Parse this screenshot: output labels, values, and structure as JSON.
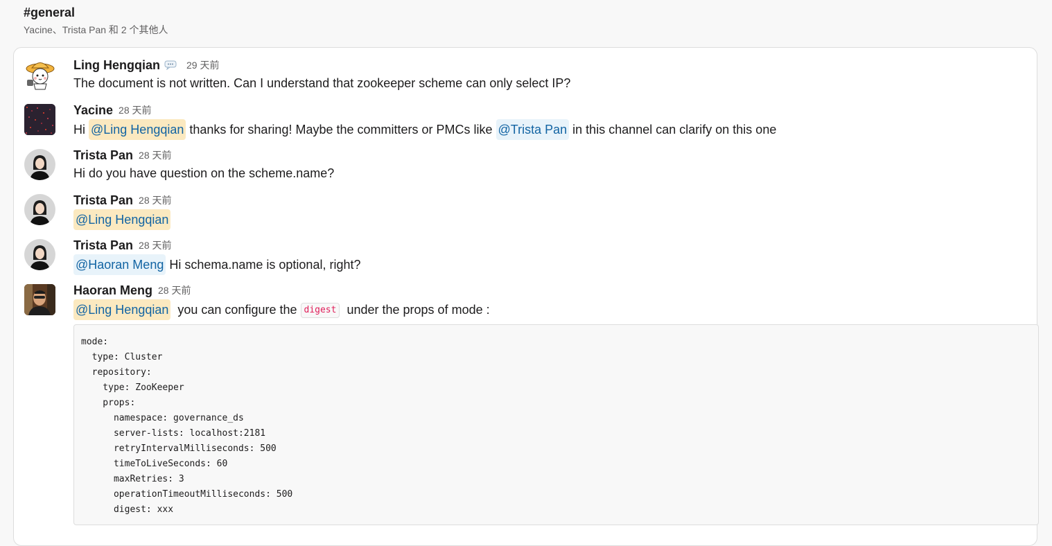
{
  "channel": {
    "name": "#general",
    "members": "Yacine、Trista Pan 和 2 个其他人"
  },
  "messages": [
    {
      "sender": "Ling Hengqian",
      "time": "29 天前",
      "status_icon": "speech-balloon-icon",
      "text": "The document is not written. Can I understand that zookeeper scheme can only select IP?"
    },
    {
      "sender": "Yacine",
      "time": "28 天前",
      "text_a": "Hi ",
      "mention_a": "@Ling Hengqian",
      "text_b": " thanks for sharing! Maybe the committers or PMCs like ",
      "mention_b": "@Trista Pan",
      "text_c": " in this channel can clarify on this one"
    },
    {
      "sender": "Trista Pan",
      "time": "28 天前",
      "text": "Hi do you have question on the scheme.name?"
    },
    {
      "sender": "Trista Pan",
      "time": "28 天前",
      "mention": "@Ling Hengqian"
    },
    {
      "sender": "Trista Pan",
      "time": "28 天前",
      "mention": "@Haoran Meng",
      "text": " Hi schema.name is optional, right?"
    },
    {
      "sender": "Haoran Meng",
      "time": "28 天前",
      "mention": "@Ling Hengqian",
      "text_a": "  you can configure the ",
      "code": "digest",
      "text_b": "  under the props of mode :",
      "code_block": [
        "mode:",
        "  type: Cluster",
        "  repository:",
        "    type: ZooKeeper",
        "    props:",
        "      namespace: governance_ds",
        "      server-lists: localhost:2181",
        "      retryIntervalMilliseconds: 500",
        "      timeToLiveSeconds: 60",
        "      maxRetries: 3",
        "      operationTimeoutMilliseconds: 500",
        "      digest: xxx"
      ]
    }
  ],
  "colors": {
    "mention_self_bg": "#fbe9c0",
    "mention_other_bg": "#e8f3fa",
    "mention_text": "#1264a3",
    "inline_code": "#e01e5a"
  }
}
